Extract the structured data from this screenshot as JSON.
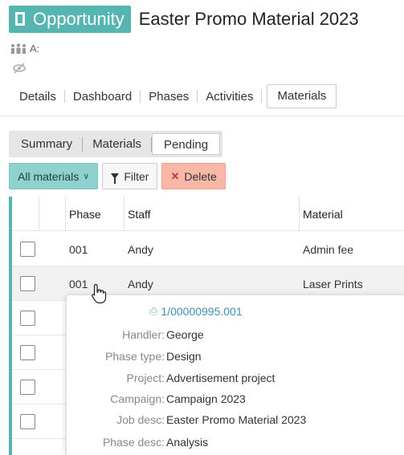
{
  "header": {
    "type_label": "Opportunity",
    "title": "Easter Promo Material 2023",
    "meta_line1": "A:",
    "meta_line2": ""
  },
  "main_tabs": [
    {
      "label": "Details"
    },
    {
      "label": "Dashboard"
    },
    {
      "label": "Phases"
    },
    {
      "label": "Activities"
    },
    {
      "label": "Materials",
      "active": true
    }
  ],
  "sub_tabs": [
    {
      "label": "Summary"
    },
    {
      "label": "Materials"
    },
    {
      "label": "Pending",
      "active": true
    }
  ],
  "toolbar": {
    "all_materials": "All materials",
    "filter": "Filter",
    "delete": "Delete"
  },
  "table": {
    "columns": [
      "Phase",
      "Staff",
      "Material"
    ],
    "rows": [
      {
        "phase": "001",
        "staff": "Andy",
        "material": "Admin fee"
      },
      {
        "phase": "001",
        "staff": "Andy",
        "material": "Laser Prints"
      },
      {
        "phase": "",
        "staff": "",
        "material": ""
      },
      {
        "phase": "",
        "staff": "",
        "material": ""
      },
      {
        "phase": "",
        "staff": "",
        "material": ""
      },
      {
        "phase": "",
        "staff": "",
        "material": ""
      }
    ]
  },
  "tooltip": {
    "reference": "1/00000995.001",
    "fields": [
      {
        "label": "Handler:",
        "value": "George"
      },
      {
        "label": "Phase type:",
        "value": "Design"
      },
      {
        "label": "Project:",
        "value": "Advertisement project"
      },
      {
        "label": "Campaign:",
        "value": "Campaign 2023"
      },
      {
        "label": "Job desc:",
        "value": "Easter Promo Material 2023"
      },
      {
        "label": "Phase desc:",
        "value": "Analysis"
      }
    ]
  },
  "colors": {
    "accent": "#56b5b0",
    "all_materials_bg": "#8fd1cf",
    "delete_bg": "#f8b7a7",
    "link": "#3d8fb3"
  },
  "icons": {
    "record_type": "document-icon",
    "people": "people-icon",
    "hidden": "eye-slash-icon",
    "filter": "funnel-icon",
    "delete": "x-icon",
    "reference": "record-link-icon",
    "cursor": "hand-pointer-cursor"
  }
}
